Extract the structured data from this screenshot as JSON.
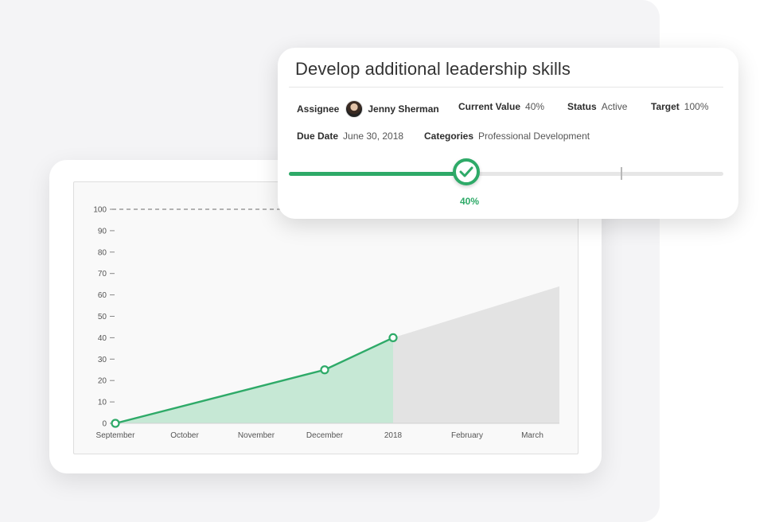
{
  "goal": {
    "title": "Develop additional leadership skills",
    "assignee_label": "Assignee",
    "assignee_name": "Jenny Sherman",
    "current_value_label": "Current Value",
    "current_value": "40%",
    "status_label": "Status",
    "status": "Active",
    "target_label": "Target",
    "target": "100%",
    "due_date_label": "Due Date",
    "due_date": "June 30, 2018",
    "categories_label": "Categories",
    "categories": "Professional Development",
    "progress_label": "40%",
    "progress_fraction": 0.4,
    "accent_color": "#2eaa68"
  },
  "chart_data": {
    "type": "area",
    "title": "",
    "xlabel": "",
    "ylabel": "",
    "ylim": [
      0,
      100
    ],
    "yticks": [
      0,
      10,
      20,
      30,
      40,
      50,
      60,
      70,
      80,
      90,
      100
    ],
    "categories": [
      "September",
      "October",
      "November",
      "December",
      "2018",
      "February",
      "March"
    ],
    "target_line": 100,
    "series": [
      {
        "values": [
          0,
          null,
          null,
          25,
          40,
          null,
          null
        ],
        "color": "#2eaa68"
      }
    ],
    "projection": {
      "from": 40,
      "to": 64,
      "color": "#e3e3e3"
    },
    "grid": false
  }
}
